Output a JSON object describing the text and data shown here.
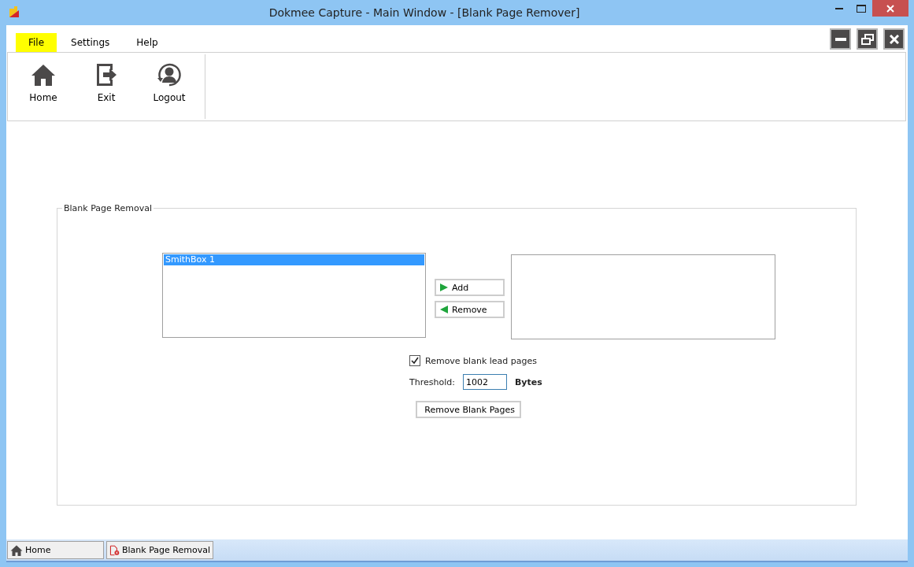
{
  "window": {
    "title": "Dokmee Capture - Main Window - [Blank Page Remover]"
  },
  "menu": [
    {
      "label": "File",
      "selected": true
    },
    {
      "label": "Settings",
      "selected": false
    },
    {
      "label": "Help",
      "selected": false
    }
  ],
  "ribbon": [
    {
      "label": "Home",
      "kind": "home"
    },
    {
      "label": "Exit",
      "kind": "exit"
    },
    {
      "label": "Logout",
      "kind": "logout"
    }
  ],
  "group": {
    "title": "Blank Page Removal",
    "source_list": [
      {
        "label": "SmithBox 1",
        "selected": true
      }
    ],
    "add_button": "Add",
    "remove_button": "Remove",
    "remove_lead": {
      "label": "Remove blank lead pages",
      "checked": true
    },
    "threshold": {
      "label": "Threshold:",
      "value": "1002",
      "unit": "Bytes"
    },
    "action_button": "Remove Blank Pages"
  },
  "bottom_tabs": [
    {
      "label": "Home",
      "kind": "home"
    },
    {
      "label": "Blank Page Removal",
      "kind": "document"
    }
  ]
}
